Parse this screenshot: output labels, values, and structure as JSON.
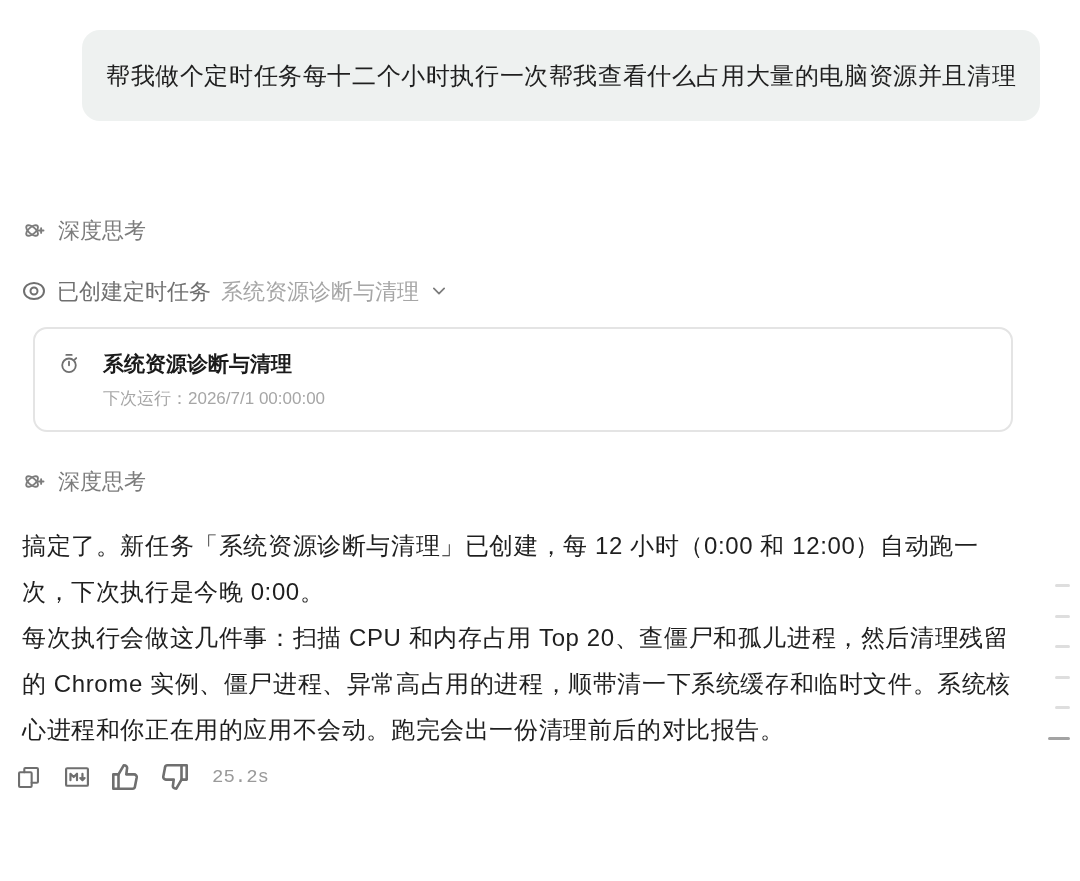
{
  "user_message": {
    "text": "帮我做个定时任务每十二个小时执行一次帮我查看什么占用大量的电脑资源并且清理"
  },
  "timeline": [
    {
      "kind": "thinking",
      "label": "深度思考"
    },
    {
      "kind": "tool_call",
      "label": "已创建定时任务",
      "detail": "系统资源诊断与清理"
    },
    {
      "kind": "task_card",
      "title": "系统资源诊断与清理",
      "subtitle": "下次运行：2026/7/1 00:00:00"
    },
    {
      "kind": "thinking",
      "label": "深度思考"
    },
    {
      "kind": "answer",
      "paragraphs": [
        "搞定了。新任务「系统资源诊断与清理」已创建，每 12 小时（0:00 和 12:00）自动跑一次，下次执行是今晚 0:00。",
        "每次执行会做这几件事：扫描 CPU 和内存占用 Top 20、查僵尸和孤儿进程，然后清理残留的 Chrome 实例、僵尸进程、异常高占用的进程，顺带清一下系统缓存和临时文件。系统核心进程和你正在用的应用不会动。跑完会出一份清理前后的对比报告。"
      ]
    }
  ],
  "actions": {
    "elapsed": "25.2s"
  },
  "outline_markers": [
    {
      "selected": false
    },
    {
      "selected": false
    },
    {
      "selected": false
    },
    {
      "selected": false
    },
    {
      "selected": false
    },
    {
      "selected": true
    }
  ]
}
